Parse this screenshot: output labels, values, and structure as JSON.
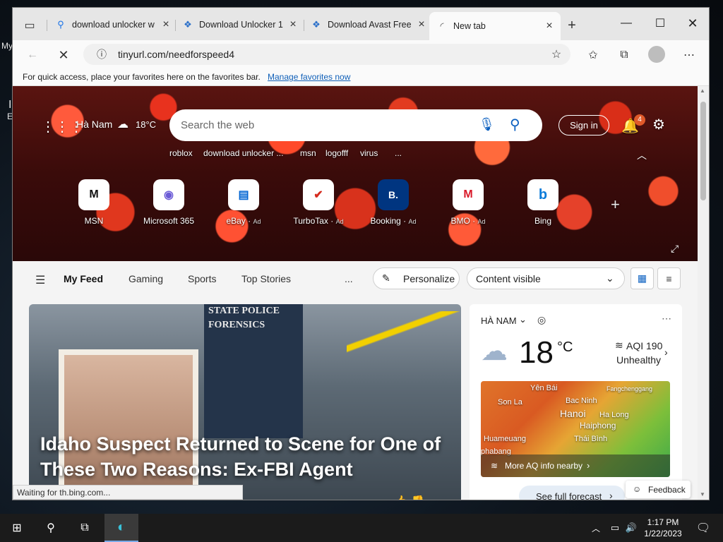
{
  "desktop": {
    "left_text_1": "My",
    "left_text_2": "I",
    "left_text_3": "E"
  },
  "tabs": [
    {
      "label": "download unlocker w",
      "icon": "search-icon"
    },
    {
      "label": "Download Unlocker 1",
      "icon": "softpedia-icon"
    },
    {
      "label": "Download Avast Free",
      "icon": "softpedia-icon"
    },
    {
      "label": "New tab",
      "icon": "loading-icon"
    }
  ],
  "toolbar": {
    "url": "tinyurl.com/needforspeed4"
  },
  "favbar": {
    "text": "For quick access, place your favorites here on the favorites bar.",
    "link": "Manage favorites now"
  },
  "hero": {
    "location": "Hà Nam",
    "temp": "18°C",
    "search_placeholder": "Search the web",
    "sign_in": "Sign in",
    "notif_count": "4",
    "chips": [
      "roblox",
      "download unlocker ...",
      "msn",
      "logofff",
      "virus",
      "..."
    ],
    "tiles": [
      {
        "label": "MSN",
        "ad": "",
        "glyph": "M",
        "color": "#111111"
      },
      {
        "label": "Microsoft 365",
        "ad": "",
        "glyph": "◉",
        "color": "#6b5bd6"
      },
      {
        "label": "eBay",
        "ad": "Ad",
        "glyph": "▤",
        "color": "#0064d2"
      },
      {
        "label": "TurboTax",
        "ad": "Ad",
        "glyph": "✔",
        "color": "#d52b1e"
      },
      {
        "label": "Booking",
        "ad": "Ad",
        "glyph": "B.",
        "color": "#003580"
      },
      {
        "label": "BMO",
        "ad": "Ad",
        "glyph": "M",
        "color": "#d91a2a"
      },
      {
        "label": "Bing",
        "ad": "",
        "glyph": "b",
        "color": "#0c7bd9"
      }
    ]
  },
  "feed": {
    "tabs": [
      "My Feed",
      "Gaming",
      "Sports",
      "Top Stories"
    ],
    "more": "...",
    "personalize": "Personalize",
    "content_visible": "Content visible"
  },
  "story": {
    "image_text": "STATE POLICE FORENSICS",
    "title": "Idaho Suspect Returned to Scene for One of These Two Reasons: Ex-FBI Agent"
  },
  "weather": {
    "location": "HÀ NAM",
    "temp": "18",
    "unit": "°C",
    "aqi": "AQI 190",
    "aqi_status": "Unhealthy",
    "map_labels": [
      "Yên Bái",
      "Son La",
      "Bac Ninh",
      "Fangchenggang",
      "Hanoi",
      "Ha Long",
      "Haiphong",
      "Huameuang",
      "Thái Bình",
      "phabang"
    ],
    "more_aq": "More AQ info nearby",
    "forecast": "See full forecast"
  },
  "status_text": "Waiting for th.bing.com...",
  "feedback": "Feedback",
  "clock": {
    "time": "1:17 PM",
    "date": "1/22/2023"
  }
}
